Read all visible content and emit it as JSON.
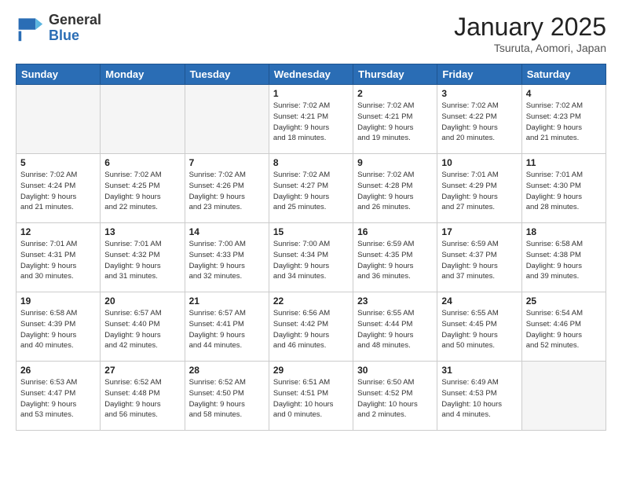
{
  "header": {
    "logo_general": "General",
    "logo_blue": "Blue",
    "month_title": "January 2025",
    "location": "Tsuruta, Aomori, Japan"
  },
  "days_of_week": [
    "Sunday",
    "Monday",
    "Tuesday",
    "Wednesday",
    "Thursday",
    "Friday",
    "Saturday"
  ],
  "weeks": [
    [
      {
        "day": "",
        "info": ""
      },
      {
        "day": "",
        "info": ""
      },
      {
        "day": "",
        "info": ""
      },
      {
        "day": "1",
        "info": "Sunrise: 7:02 AM\nSunset: 4:21 PM\nDaylight: 9 hours\nand 18 minutes."
      },
      {
        "day": "2",
        "info": "Sunrise: 7:02 AM\nSunset: 4:21 PM\nDaylight: 9 hours\nand 19 minutes."
      },
      {
        "day": "3",
        "info": "Sunrise: 7:02 AM\nSunset: 4:22 PM\nDaylight: 9 hours\nand 20 minutes."
      },
      {
        "day": "4",
        "info": "Sunrise: 7:02 AM\nSunset: 4:23 PM\nDaylight: 9 hours\nand 21 minutes."
      }
    ],
    [
      {
        "day": "5",
        "info": "Sunrise: 7:02 AM\nSunset: 4:24 PM\nDaylight: 9 hours\nand 21 minutes."
      },
      {
        "day": "6",
        "info": "Sunrise: 7:02 AM\nSunset: 4:25 PM\nDaylight: 9 hours\nand 22 minutes."
      },
      {
        "day": "7",
        "info": "Sunrise: 7:02 AM\nSunset: 4:26 PM\nDaylight: 9 hours\nand 23 minutes."
      },
      {
        "day": "8",
        "info": "Sunrise: 7:02 AM\nSunset: 4:27 PM\nDaylight: 9 hours\nand 25 minutes."
      },
      {
        "day": "9",
        "info": "Sunrise: 7:02 AM\nSunset: 4:28 PM\nDaylight: 9 hours\nand 26 minutes."
      },
      {
        "day": "10",
        "info": "Sunrise: 7:01 AM\nSunset: 4:29 PM\nDaylight: 9 hours\nand 27 minutes."
      },
      {
        "day": "11",
        "info": "Sunrise: 7:01 AM\nSunset: 4:30 PM\nDaylight: 9 hours\nand 28 minutes."
      }
    ],
    [
      {
        "day": "12",
        "info": "Sunrise: 7:01 AM\nSunset: 4:31 PM\nDaylight: 9 hours\nand 30 minutes."
      },
      {
        "day": "13",
        "info": "Sunrise: 7:01 AM\nSunset: 4:32 PM\nDaylight: 9 hours\nand 31 minutes."
      },
      {
        "day": "14",
        "info": "Sunrise: 7:00 AM\nSunset: 4:33 PM\nDaylight: 9 hours\nand 32 minutes."
      },
      {
        "day": "15",
        "info": "Sunrise: 7:00 AM\nSunset: 4:34 PM\nDaylight: 9 hours\nand 34 minutes."
      },
      {
        "day": "16",
        "info": "Sunrise: 6:59 AM\nSunset: 4:35 PM\nDaylight: 9 hours\nand 36 minutes."
      },
      {
        "day": "17",
        "info": "Sunrise: 6:59 AM\nSunset: 4:37 PM\nDaylight: 9 hours\nand 37 minutes."
      },
      {
        "day": "18",
        "info": "Sunrise: 6:58 AM\nSunset: 4:38 PM\nDaylight: 9 hours\nand 39 minutes."
      }
    ],
    [
      {
        "day": "19",
        "info": "Sunrise: 6:58 AM\nSunset: 4:39 PM\nDaylight: 9 hours\nand 40 minutes."
      },
      {
        "day": "20",
        "info": "Sunrise: 6:57 AM\nSunset: 4:40 PM\nDaylight: 9 hours\nand 42 minutes."
      },
      {
        "day": "21",
        "info": "Sunrise: 6:57 AM\nSunset: 4:41 PM\nDaylight: 9 hours\nand 44 minutes."
      },
      {
        "day": "22",
        "info": "Sunrise: 6:56 AM\nSunset: 4:42 PM\nDaylight: 9 hours\nand 46 minutes."
      },
      {
        "day": "23",
        "info": "Sunrise: 6:55 AM\nSunset: 4:44 PM\nDaylight: 9 hours\nand 48 minutes."
      },
      {
        "day": "24",
        "info": "Sunrise: 6:55 AM\nSunset: 4:45 PM\nDaylight: 9 hours\nand 50 minutes."
      },
      {
        "day": "25",
        "info": "Sunrise: 6:54 AM\nSunset: 4:46 PM\nDaylight: 9 hours\nand 52 minutes."
      }
    ],
    [
      {
        "day": "26",
        "info": "Sunrise: 6:53 AM\nSunset: 4:47 PM\nDaylight: 9 hours\nand 53 minutes."
      },
      {
        "day": "27",
        "info": "Sunrise: 6:52 AM\nSunset: 4:48 PM\nDaylight: 9 hours\nand 56 minutes."
      },
      {
        "day": "28",
        "info": "Sunrise: 6:52 AM\nSunset: 4:50 PM\nDaylight: 9 hours\nand 58 minutes."
      },
      {
        "day": "29",
        "info": "Sunrise: 6:51 AM\nSunset: 4:51 PM\nDaylight: 10 hours\nand 0 minutes."
      },
      {
        "day": "30",
        "info": "Sunrise: 6:50 AM\nSunset: 4:52 PM\nDaylight: 10 hours\nand 2 minutes."
      },
      {
        "day": "31",
        "info": "Sunrise: 6:49 AM\nSunset: 4:53 PM\nDaylight: 10 hours\nand 4 minutes."
      },
      {
        "day": "",
        "info": ""
      }
    ]
  ]
}
